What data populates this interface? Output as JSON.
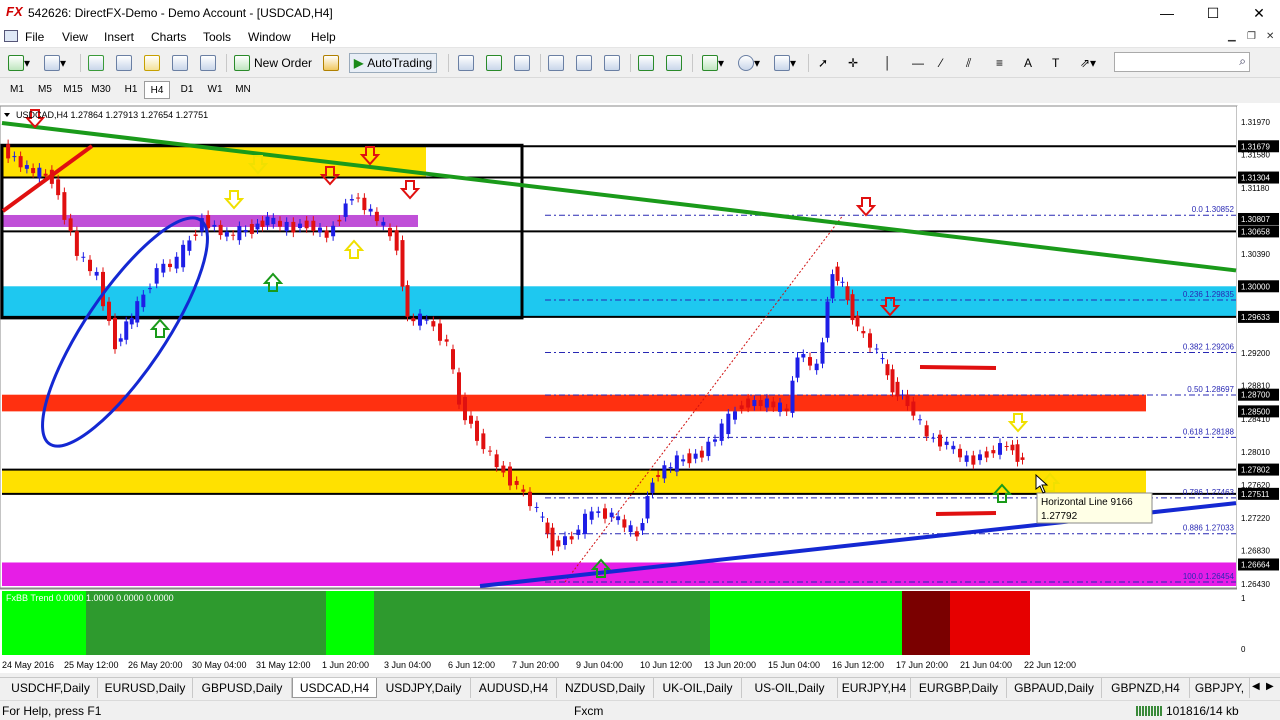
{
  "window": {
    "logo": "FX",
    "title": "542626: DirectFX-Demo - Demo Account - [USDCAD,H4]",
    "minimize": "—",
    "maximize": "☐",
    "close": "✕"
  },
  "menu": {
    "items": [
      "File",
      "View",
      "Insert",
      "Charts",
      "Tools",
      "Window",
      "Help"
    ]
  },
  "toolbar": {
    "new_order": "New Order",
    "autotrading": "AutoTrading"
  },
  "timeframes": [
    "M1",
    "M5",
    "M15",
    "M30",
    "H1",
    "H4",
    "D1",
    "W1",
    "MN"
  ],
  "timeframe_active": "H4",
  "chart": {
    "header": "USDCAD,H4  1.27864 1.27913 1.27654 1.27751",
    "indicator_label": "FxBB Trend 0.0000 1.0000 0.0000 0.0000",
    "price_labels": [
      {
        "v": "1.31970",
        "hl": false
      },
      {
        "v": "1.31679",
        "hl": true
      },
      {
        "v": "1.31580",
        "hl": false
      },
      {
        "v": "1.31304",
        "hl": true
      },
      {
        "v": "1.31180",
        "hl": false
      },
      {
        "v": "1.30807",
        "hl": true
      },
      {
        "v": "1.30658",
        "hl": true
      },
      {
        "v": "1.30390",
        "hl": false
      },
      {
        "v": "1.30000",
        "hl": true
      },
      {
        "v": "1.29633",
        "hl": true
      },
      {
        "v": "1.29200",
        "hl": false
      },
      {
        "v": "1.28810",
        "hl": false
      },
      {
        "v": "1.28700",
        "hl": true
      },
      {
        "v": "1.28500",
        "hl": true
      },
      {
        "v": "1.28410",
        "hl": false
      },
      {
        "v": "1.28010",
        "hl": false
      },
      {
        "v": "1.27802",
        "hl": true
      },
      {
        "v": "1.27620",
        "hl": false
      },
      {
        "v": "1.27511",
        "hl": true
      },
      {
        "v": "1.27220",
        "hl": false
      },
      {
        "v": "1.26830",
        "hl": false
      },
      {
        "v": "1.26664",
        "hl": true
      },
      {
        "v": "1.26430",
        "hl": false
      }
    ],
    "fib_labels": [
      "0.0  1.30852",
      "0.236  1.29835",
      "0.382  1.29206",
      "0.50  1.28697",
      "0.618  1.28188",
      "0.786  1.27463",
      "0.886  1.27033",
      "100.0  1.26454"
    ],
    "indicator_scale": [
      "1",
      "0"
    ],
    "tooltip_title": "Horizontal Line 9166",
    "tooltip_value": "1.27792",
    "dates": [
      "24 May 2016",
      "25 May 12:00",
      "26 May 20:00",
      "30 May 04:00",
      "31 May 12:00",
      "1 Jun 20:00",
      "3 Jun 04:00",
      "6 Jun 12:00",
      "7 Jun 20:00",
      "9 Jun 04:00",
      "10 Jun 12:00",
      "13 Jun 20:00",
      "15 Jun 04:00",
      "16 Jun 12:00",
      "17 Jun 20:00",
      "21 Jun 04:00",
      "22 Jun 12:00"
    ]
  },
  "tabs": [
    "USDCHF,Daily",
    "EURUSD,Daily",
    "GBPUSD,Daily",
    "USDCAD,H4",
    "USDJPY,Daily",
    "AUDUSD,H4",
    "NZDUSD,Daily",
    "UK-OIL,Daily",
    "US-OIL,Daily",
    "EURJPY,H4",
    "EURGBP,Daily",
    "GBPAUD,Daily",
    "GBPNZD,H4",
    "GBPJPY,"
  ],
  "tab_active": "USDCAD,H4",
  "status": {
    "help": "For Help, press F1",
    "profile": "Fxcm",
    "traffic": "101816/14 kb"
  },
  "colors": {
    "bull": "#1e1ee6",
    "bear": "#e01010",
    "zone_yellow": "#ffe100",
    "zone_cyan": "#1ec8f0",
    "zone_red": "#ff3010",
    "zone_magenta": "#e61ee6",
    "zone_purple": "#c050d8",
    "trend_green": "#1a9a1a",
    "trend_blue": "#1428d2"
  }
}
